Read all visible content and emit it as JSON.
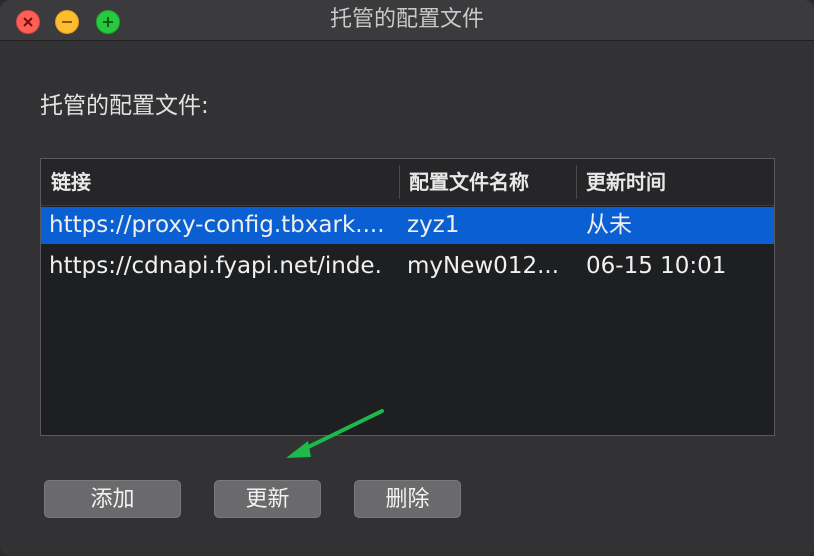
{
  "window": {
    "title": "托管的配置文件"
  },
  "section_label": "托管的配置文件:",
  "table": {
    "headers": [
      "链接",
      "配置文件名称",
      "更新时间"
    ],
    "rows": [
      {
        "link": "https://proxy-config.tbxark....",
        "name": "zyz1",
        "updated": "从未",
        "selected": true
      },
      {
        "link": "https://cdnapi.fyapi.net/inde.",
        "name": "myNew012...",
        "updated": "06-15 10:01",
        "selected": false
      }
    ]
  },
  "buttons": {
    "add": "添加",
    "update": "更新",
    "delete": "删除"
  },
  "annotation": {
    "arrow_color": "#1db94a"
  }
}
